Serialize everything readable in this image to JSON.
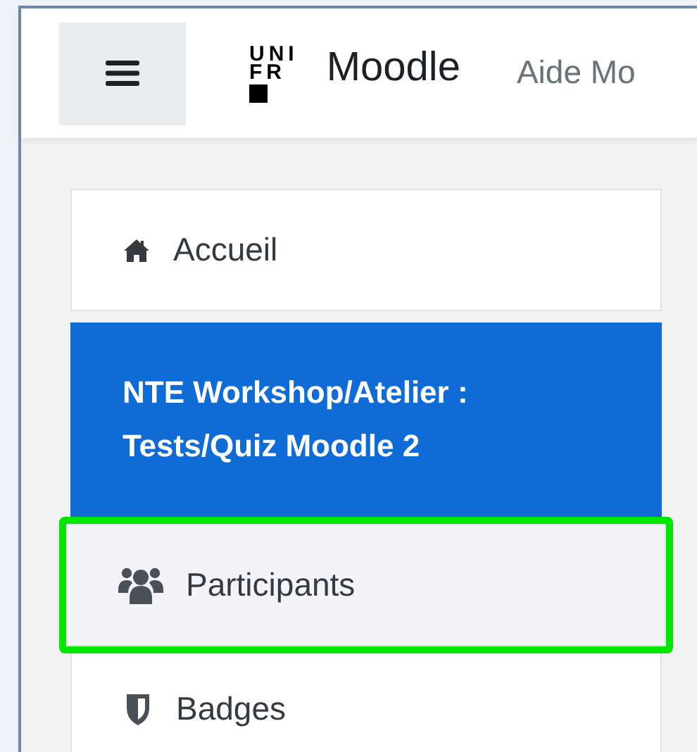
{
  "header": {
    "logo": {
      "lines": [
        "UNI",
        "FR"
      ]
    },
    "site_name": "Moodle",
    "nav_link": "Aide Mo"
  },
  "nav": {
    "items": [
      {
        "label": "Accueil",
        "kind": "link",
        "selected": false,
        "highlighted": false
      },
      {
        "label": "NTE Workshop/Atelier : Tests/Quiz Moodle 2",
        "kind": "course",
        "selected": true,
        "highlighted": false
      },
      {
        "label": "Participants",
        "kind": "link",
        "selected": false,
        "highlighted": true
      },
      {
        "label": "Badges",
        "kind": "link",
        "selected": false,
        "highlighted": false
      }
    ]
  }
}
